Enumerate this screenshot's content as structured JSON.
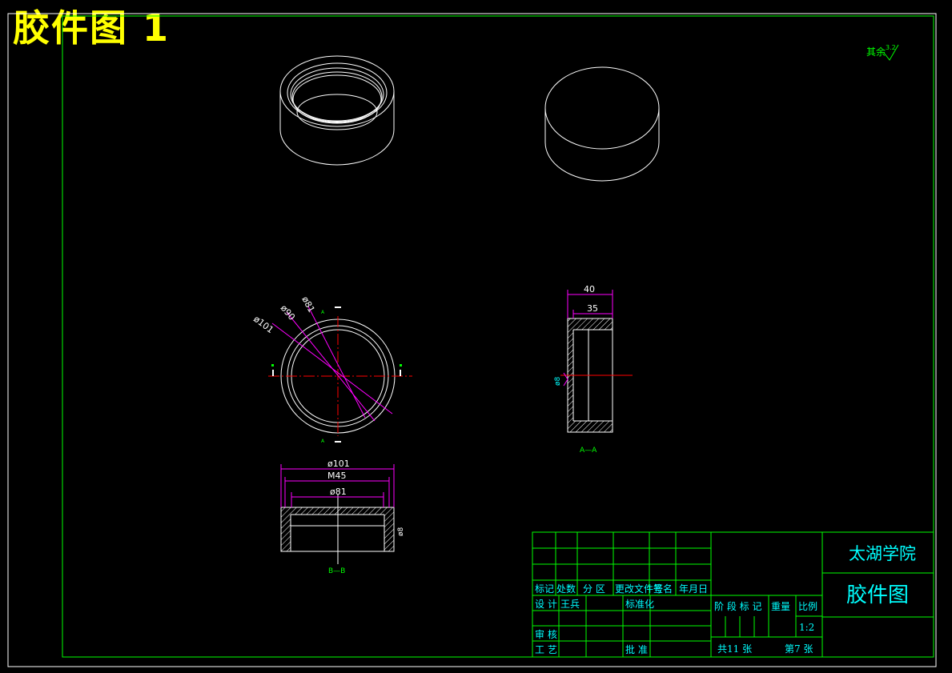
{
  "drawing_title": "胶件图 1",
  "surface_note": {
    "prefix": "其余",
    "value": "3.2"
  },
  "dimensions": {
    "top_view": [
      "ø101",
      "ø90",
      "ø81"
    ],
    "side_view": [
      "40",
      "35",
      "ø8"
    ],
    "section_bb": [
      "ø101",
      "M45",
      "ø81",
      "ø8"
    ]
  },
  "section_labels": {
    "aa": "A—A",
    "bb": "B—B",
    "cut_a": "A",
    "cut_b": "B"
  },
  "title_block": {
    "school": "太湖学院",
    "drawing_name": "胶件图",
    "header_row": [
      "标记",
      "处数",
      "分 区",
      "更改文件号",
      "签名",
      "年月日"
    ],
    "design_label": "设 计",
    "designer": "王兵",
    "standardize_label": "标准化",
    "review_label": "审 核",
    "process_label": "工 艺",
    "approve_label": "批 准",
    "stage_label": "阶 段 标 记",
    "weight_label": "重量",
    "scale_label": "比例",
    "scale": "1:2",
    "total_sheets": "共11 张",
    "sheet_no": "第7 张"
  },
  "colors": {
    "border": "#00ff00",
    "lines": "#ffffff",
    "dimension": "#ff00ff",
    "centerline": "#ff0000",
    "text_cyan": "#00ffff",
    "text_yellow": "#ffff00",
    "text_green": "#00ff00"
  }
}
